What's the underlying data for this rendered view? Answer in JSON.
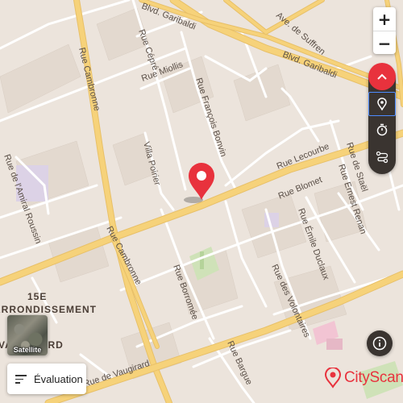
{
  "map": {
    "streets": {
      "bvd_garibaldi_top": "Blvd. Garibaldi",
      "bvd_garibaldi_right": "Blvd. Garibaldi",
      "ave_suffren": "Ave. de Suffren",
      "rue_cepre": "Rue Cépré",
      "rue_miollis": "Rue Miollis",
      "rue_cambronne_top": "Rue Cambronne",
      "rue_cambronne_bottom": "Rue Cambronne",
      "rue_francois_bonvin": "Rue François Bonvin",
      "villa_poirier": "Villa Poirier",
      "rue_lecourbe": "Rue Lecourbe",
      "rue_blomet": "Rue Blomet",
      "rue_de_stael": "Rue de Staël",
      "rue_ernest_renan": "Rue Ernest Renan",
      "rue_emile_duclaux": "Rue Émile Duclaux",
      "rue_amiral_roussin": "Rue de l'Amiral Roussin",
      "rue_borromee": "Rue Borromée",
      "rue_des_volontaires": "Rue des Volontaires",
      "rue_vaugirard": "Rue de Vaugirard",
      "rue_bargue": "Rue Bargue"
    },
    "district_line1": "15E",
    "district_line2": "ARRONDISSEMENT",
    "district_line3": "VAUGIRARD"
  },
  "zoom": {
    "in": "+",
    "out": "−"
  },
  "panel": {
    "toggle_icon": "chevron-up-icon",
    "items": [
      {
        "icon": "location-pin-icon",
        "active": true
      },
      {
        "icon": "stopwatch-icon",
        "active": false
      },
      {
        "icon": "route-icon",
        "active": false
      }
    ]
  },
  "info_icon": "info-icon",
  "satellite": {
    "label": "Satellite"
  },
  "evaluation": {
    "label": "Évaluation"
  },
  "brand": {
    "name": "CityScan",
    "color": "#e8323d"
  },
  "colors": {
    "accent": "#e8323d",
    "major_road": "#f6d27a",
    "land": "#ece4dc",
    "park": "#cfe2b8"
  }
}
